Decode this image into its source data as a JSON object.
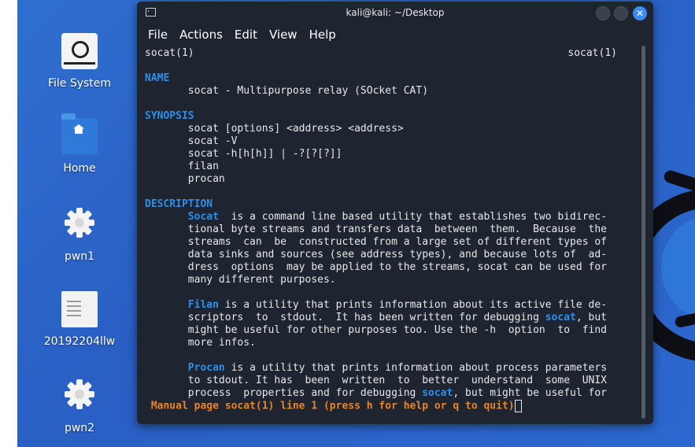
{
  "desktop": {
    "icons": [
      {
        "label": "File System",
        "icon": "drive-icon"
      },
      {
        "label": "Home",
        "icon": "home-folder-icon"
      },
      {
        "label": "pwn1",
        "icon": "gear-icon"
      },
      {
        "label": "20192204llw",
        "icon": "document-icon"
      },
      {
        "label": "pwn2",
        "icon": "gear-icon"
      }
    ],
    "colors": {
      "background": "#2f6fd0",
      "accent": "#2f8fe6"
    }
  },
  "window": {
    "title": "kali@kali: ~/Desktop",
    "close_glyph": "✕"
  },
  "menu": {
    "items": [
      "File",
      "Actions",
      "Edit",
      "View",
      "Help"
    ]
  },
  "man": {
    "header_left": "socat(1)",
    "header_right": "socat(1)",
    "name_heading": "NAME",
    "name_line": "       socat - Multipurpose relay (SOcket CAT)",
    "synopsis_heading": "SYNOPSIS",
    "synopsis_lines": [
      "       socat [options] <address> <address>",
      "       socat -V",
      "       socat -h[h[h]] | -?[?[?]]",
      "       filan",
      "       procan"
    ],
    "description_heading": "DESCRIPTION",
    "desc1_bold": "Socat",
    "desc1_first": "  is a command line based utility that establishes two bidirec-",
    "desc1_lines": [
      "       tional byte streams and transfers data  between  them.  Because  the",
      "       streams  can  be  constructed from a large set of different types of",
      "       data sinks and sources (see address types), and because lots of  ad-",
      "       dress  options  may be applied to the streams, socat can be used for",
      "       many different purposes."
    ],
    "desc2_bold": "Filan",
    "desc2_first": " is a utility that prints information about its active file de-",
    "desc2_l2_a": "       scriptors  to  stdout.  It has been written for debugging ",
    "desc2_l2_b": "socat",
    "desc2_l2_c": ", but",
    "desc2_lines": [
      "       might be useful for other purposes too. Use the -h  option  to  find",
      "       more infos."
    ],
    "desc3_bold": "Procan",
    "desc3_first": " is a utility that prints information about process parameters",
    "desc3_l2": "       to stdout. It has  been  written  to  better  understand  some  UNIX",
    "desc3_l3_a": "       process  properties and for debugging ",
    "desc3_l3_b": "socat",
    "desc3_l3_c": ", but might be useful for",
    "status": "Manual page socat(1) line 1 (press h for help or q to quit)"
  }
}
